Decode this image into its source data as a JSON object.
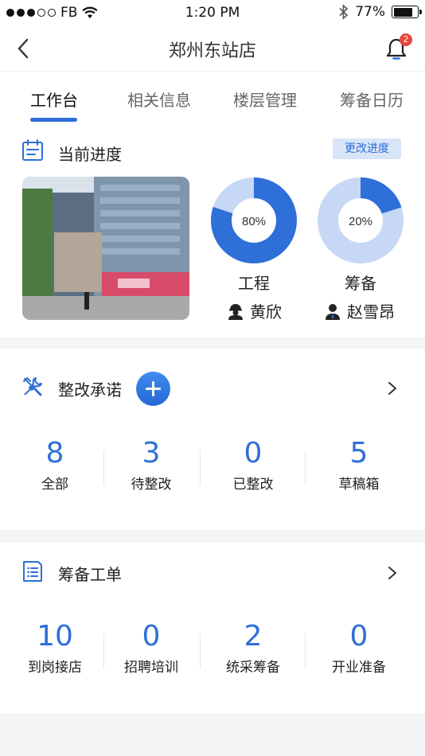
{
  "status_bar": {
    "carrier": "FB",
    "time": "1:20 PM",
    "battery": "77%",
    "battery_level": 0.77
  },
  "nav": {
    "title": "郑州东站店",
    "notification_count": "2"
  },
  "tabs": [
    {
      "label": "工作台",
      "active": true
    },
    {
      "label": "相关信息",
      "active": false
    },
    {
      "label": "楼层管理",
      "active": false
    },
    {
      "label": "筹备日历",
      "active": false
    }
  ],
  "progress": {
    "title": "当前进度",
    "change_button": "更改进度",
    "items": [
      {
        "percent_text": "80%",
        "percent": 80,
        "label": "工程",
        "person": "黄欣"
      },
      {
        "percent_text": "20%",
        "percent": 20,
        "label": "筹备",
        "person": "赵雪昂"
      }
    ]
  },
  "rectification": {
    "title": "整改承诺",
    "stats": [
      {
        "value": "8",
        "label": "全部"
      },
      {
        "value": "3",
        "label": "待整改"
      },
      {
        "value": "0",
        "label": "已整改"
      },
      {
        "value": "5",
        "label": "草稿箱"
      }
    ]
  },
  "work_orders": {
    "title": "筹备工单",
    "stats": [
      {
        "value": "10",
        "label": "到岗接店"
      },
      {
        "value": "0",
        "label": "招聘培训"
      },
      {
        "value": "2",
        "label": "统采筹备"
      },
      {
        "value": "0",
        "label": "开业准备"
      }
    ]
  },
  "colors": {
    "accent": "#2e6fd8",
    "ring_track": "#c6d8f5",
    "badge": "#e6453c"
  }
}
